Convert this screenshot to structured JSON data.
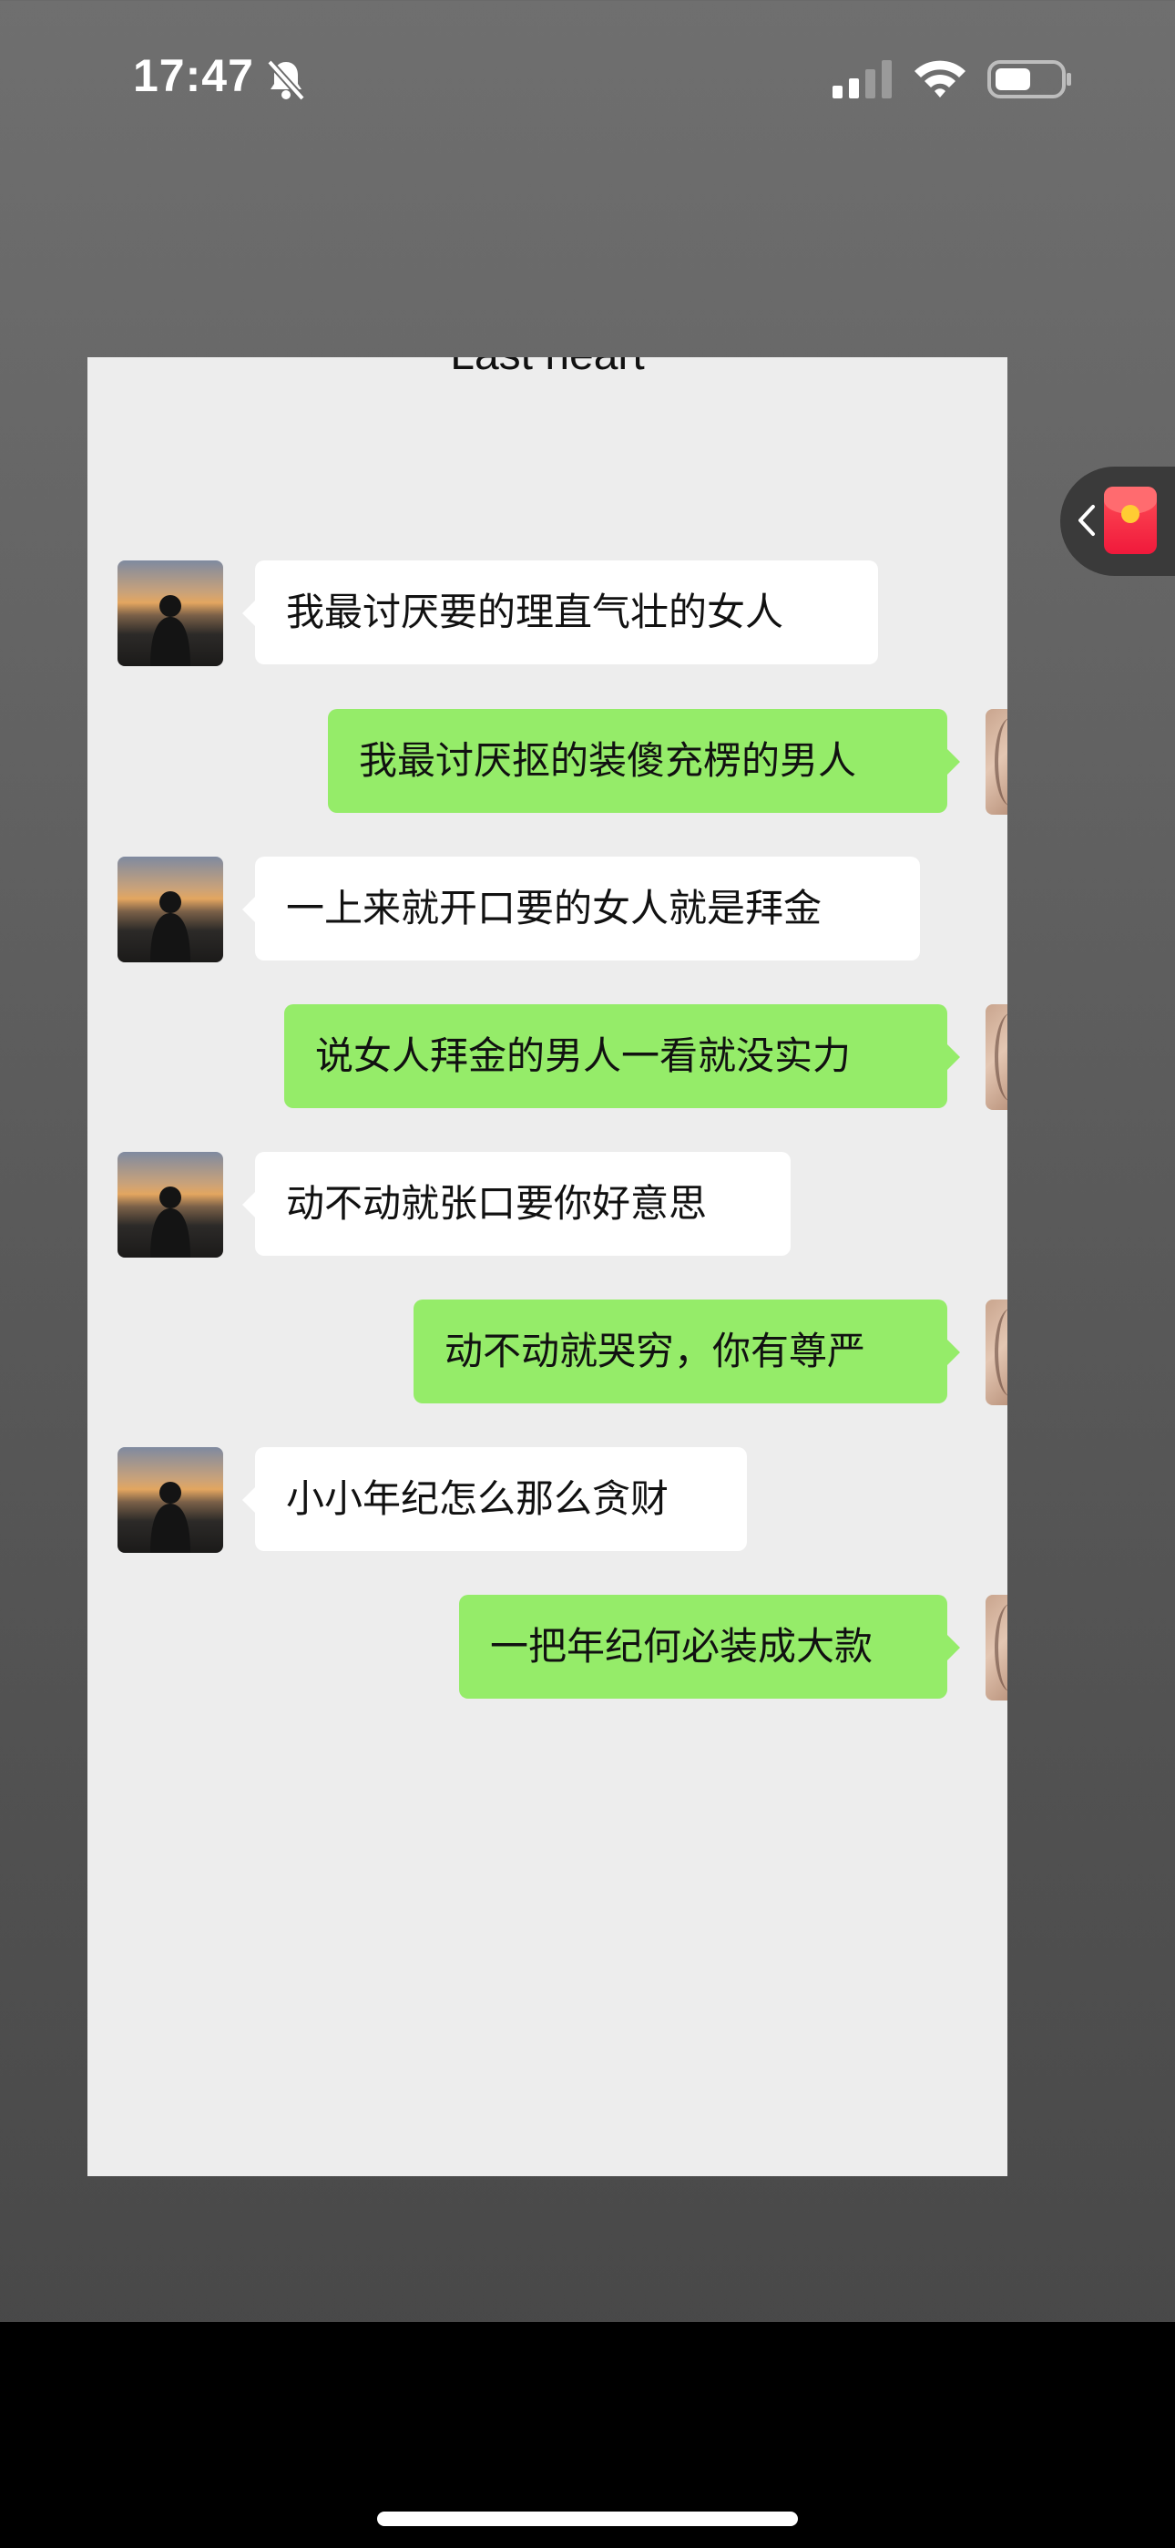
{
  "status_bar": {
    "time": "17:47",
    "icons": [
      "bell-slash-icon",
      "cellular-signal-icon",
      "wifi-icon",
      "battery-icon"
    ]
  },
  "chat": {
    "title": "Last heart",
    "colors": {
      "incoming_bubble": "#ffffff",
      "outgoing_bubble": "#95ec69",
      "background": "#ededed"
    },
    "messages": [
      {
        "side": "left",
        "text": "我最讨厌要的理直气壮的女人"
      },
      {
        "side": "right",
        "text": "我最讨厌抠的装傻充楞的男人"
      },
      {
        "side": "left",
        "text": "一上来就开口要的女人就是拜金"
      },
      {
        "side": "right",
        "text": "说女人拜金的男人一看就没实力"
      },
      {
        "side": "left",
        "text": "动不动就张口要你好意思"
      },
      {
        "side": "right",
        "text": "动不动就哭穷，你有尊严"
      },
      {
        "side": "left",
        "text": "小小年纪怎么那么贪财"
      },
      {
        "side": "right",
        "text": "一把年纪何必装成大款"
      }
    ]
  },
  "floating_widget": {
    "icons": [
      "chevron-left-icon",
      "red-packet-icon"
    ]
  }
}
